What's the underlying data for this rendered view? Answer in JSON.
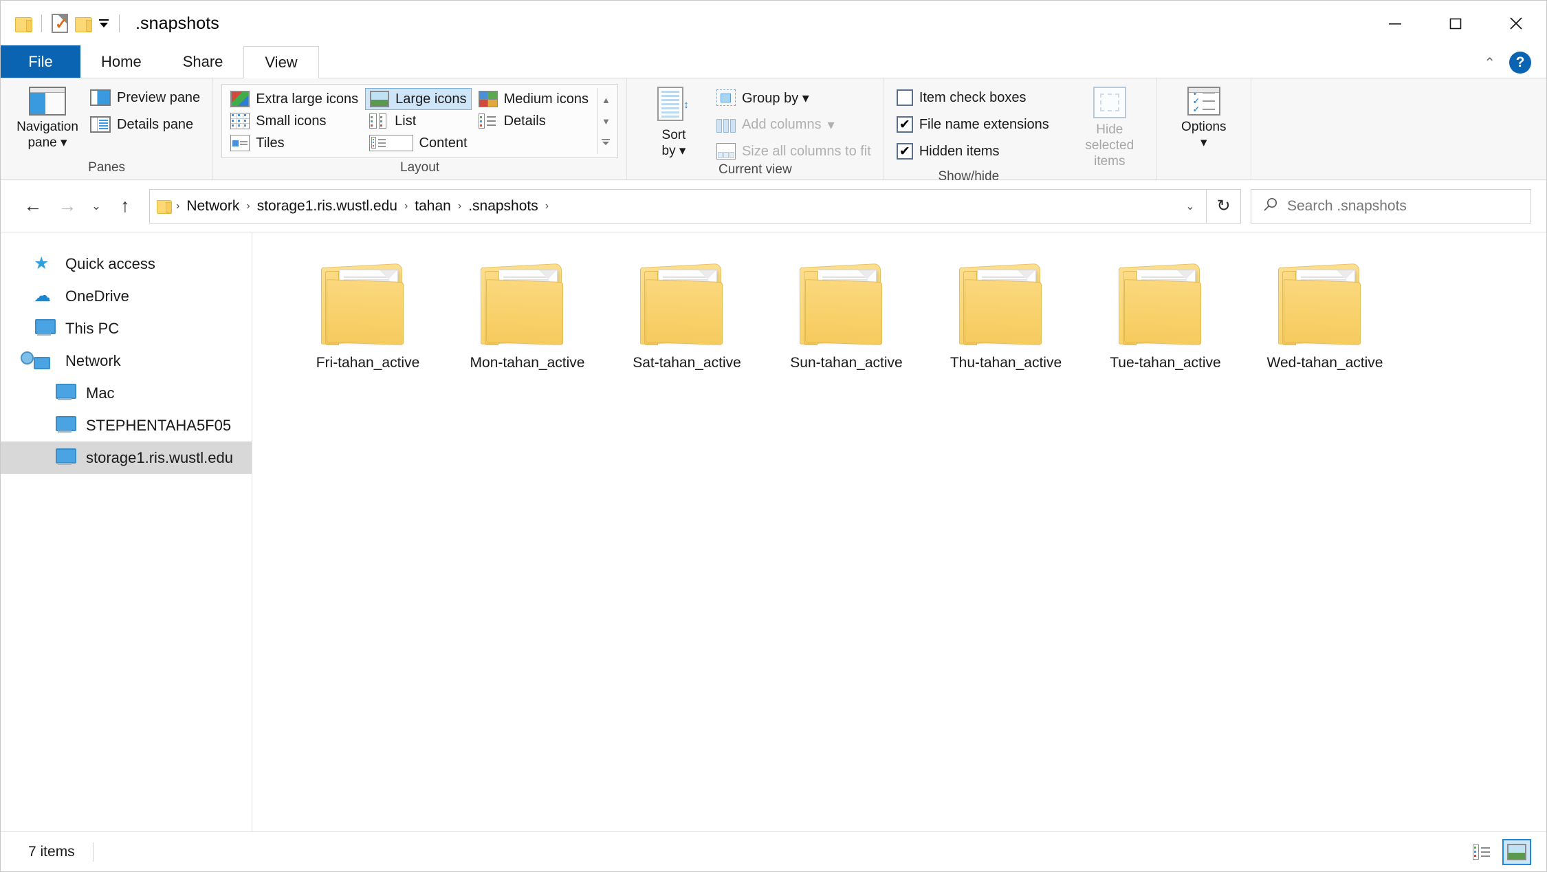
{
  "window": {
    "title": ".snapshots",
    "quick_access_toolbar": [
      {
        "name": "folder-icon",
        "label": "Folder"
      },
      {
        "name": "properties-icon",
        "label": "Properties"
      },
      {
        "name": "new-folder-icon",
        "label": "New folder"
      },
      {
        "name": "customize-caret-icon",
        "label": "Customize Quick Access Toolbar"
      }
    ],
    "controls": {
      "minimize": "—",
      "maximize": "□",
      "close": "✕"
    }
  },
  "tabs": [
    {
      "label": "File",
      "active": false,
      "kind": "file"
    },
    {
      "label": "Home",
      "active": false,
      "kind": "normal"
    },
    {
      "label": "Share",
      "active": false,
      "kind": "normal"
    },
    {
      "label": "View",
      "active": true,
      "kind": "normal"
    }
  ],
  "ribbon_right": {
    "collapse_label": "⌃",
    "help_label": "?"
  },
  "ribbon": {
    "groups": [
      {
        "name": "panes",
        "label": "Panes",
        "big_button": {
          "label_line1": "Navigation",
          "label_line2": "pane ▾"
        },
        "items": [
          {
            "label": "Preview pane",
            "enabled": true
          },
          {
            "label": "Details pane",
            "enabled": true
          }
        ]
      },
      {
        "name": "layout",
        "label": "Layout",
        "items": [
          {
            "label": "Extra large icons",
            "selected": false
          },
          {
            "label": "Large icons",
            "selected": true
          },
          {
            "label": "Medium icons",
            "selected": false
          },
          {
            "label": "Small icons",
            "selected": false
          },
          {
            "label": "List",
            "selected": false
          },
          {
            "label": "Details",
            "selected": false
          },
          {
            "label": "Tiles",
            "selected": false
          },
          {
            "label": "Content",
            "selected": false
          }
        ],
        "scroll": {
          "up": "▲",
          "down": "▼",
          "more": "▬"
        }
      },
      {
        "name": "current-view",
        "label": "Current view",
        "big_button": {
          "label_line1": "Sort",
          "label_line2": "by ▾"
        },
        "items": [
          {
            "label": "Group by ▾",
            "enabled": true
          },
          {
            "label": "Add columns",
            "enabled": false,
            "caret": "▾"
          },
          {
            "label": "Size all columns to fit",
            "enabled": false
          }
        ]
      },
      {
        "name": "show-hide",
        "label": "Show/hide",
        "checkboxes": [
          {
            "label": "Item check boxes",
            "checked": false
          },
          {
            "label": "File name extensions",
            "checked": true
          },
          {
            "label": "Hidden items",
            "checked": true
          }
        ],
        "big_button": {
          "label_line1": "Hide selected",
          "label_line2": "items",
          "enabled": false
        }
      },
      {
        "name": "options",
        "label": "",
        "big_button": {
          "label_line1": "Options",
          "label_line2": "▾"
        }
      }
    ]
  },
  "addressbar": {
    "back": "←",
    "forward": "→",
    "recent": "⌄",
    "up": "↑",
    "breadcrumbs": [
      "Network",
      "storage1.ris.wustl.edu",
      "tahan",
      ".snapshots"
    ],
    "separator": "›",
    "dropdown": "⌄",
    "refresh": "↻"
  },
  "search": {
    "placeholder": "Search .snapshots",
    "icon": "search-icon"
  },
  "sidebar": {
    "items": [
      {
        "label": "Quick access",
        "icon": "star-icon",
        "level": 0,
        "selected": false
      },
      {
        "label": "OneDrive",
        "icon": "cloud-icon",
        "level": 0,
        "selected": false
      },
      {
        "label": "This PC",
        "icon": "pc-icon",
        "level": 0,
        "selected": false
      },
      {
        "label": "Network",
        "icon": "network-icon",
        "level": 0,
        "selected": false
      },
      {
        "label": "Mac",
        "icon": "pc-icon",
        "level": 1,
        "selected": false
      },
      {
        "label": "STEPHENTAHA5F05",
        "icon": "pc-icon",
        "level": 1,
        "selected": false
      },
      {
        "label": "storage1.ris.wustl.edu",
        "icon": "pc-icon",
        "level": 1,
        "selected": true
      }
    ]
  },
  "content": {
    "items": [
      {
        "name": "Fri-tahan_active",
        "type": "folder"
      },
      {
        "name": "Mon-tahan_active",
        "type": "folder"
      },
      {
        "name": "Sat-tahan_active",
        "type": "folder"
      },
      {
        "name": "Sun-tahan_active",
        "type": "folder"
      },
      {
        "name": "Thu-tahan_active",
        "type": "folder"
      },
      {
        "name": "Tue-tahan_active",
        "type": "folder"
      },
      {
        "name": "Wed-tahan_active",
        "type": "folder"
      }
    ]
  },
  "statusbar": {
    "item_count": "7 items",
    "view_buttons": [
      {
        "name": "details-view-button",
        "label": "Details view",
        "active": false
      },
      {
        "name": "large-icons-view-button",
        "label": "Large icons view",
        "active": true
      }
    ]
  },
  "colors": {
    "accent": "#0b64b1",
    "selection": "#cde5f7",
    "folder": "#fcd975",
    "sidebar_selected": "#d8d8d8"
  }
}
